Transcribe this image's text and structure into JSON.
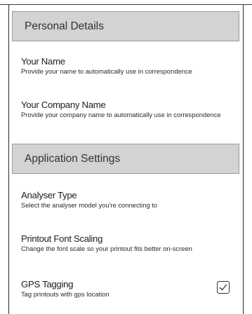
{
  "sections": [
    {
      "header": "Personal Details",
      "items": [
        {
          "title": "Your Name",
          "description": "Provide your name to automatically use in correspondence"
        },
        {
          "title": "Your Company Name",
          "description": "Provide your company name to automatically use in correspondence"
        }
      ]
    },
    {
      "header": "Application Settings",
      "items": [
        {
          "title": "Analyser Type",
          "description": "Select the analyser model you're connecting to"
        },
        {
          "title": "Printout Font Scaling",
          "description": "Change the font scale so your printout fits better on-screen"
        },
        {
          "title": "GPS Tagging",
          "description": "Tag printouts with gps location",
          "checked": true
        }
      ]
    }
  ],
  "icons": {
    "checkbox_checked": "checkmark-icon"
  }
}
